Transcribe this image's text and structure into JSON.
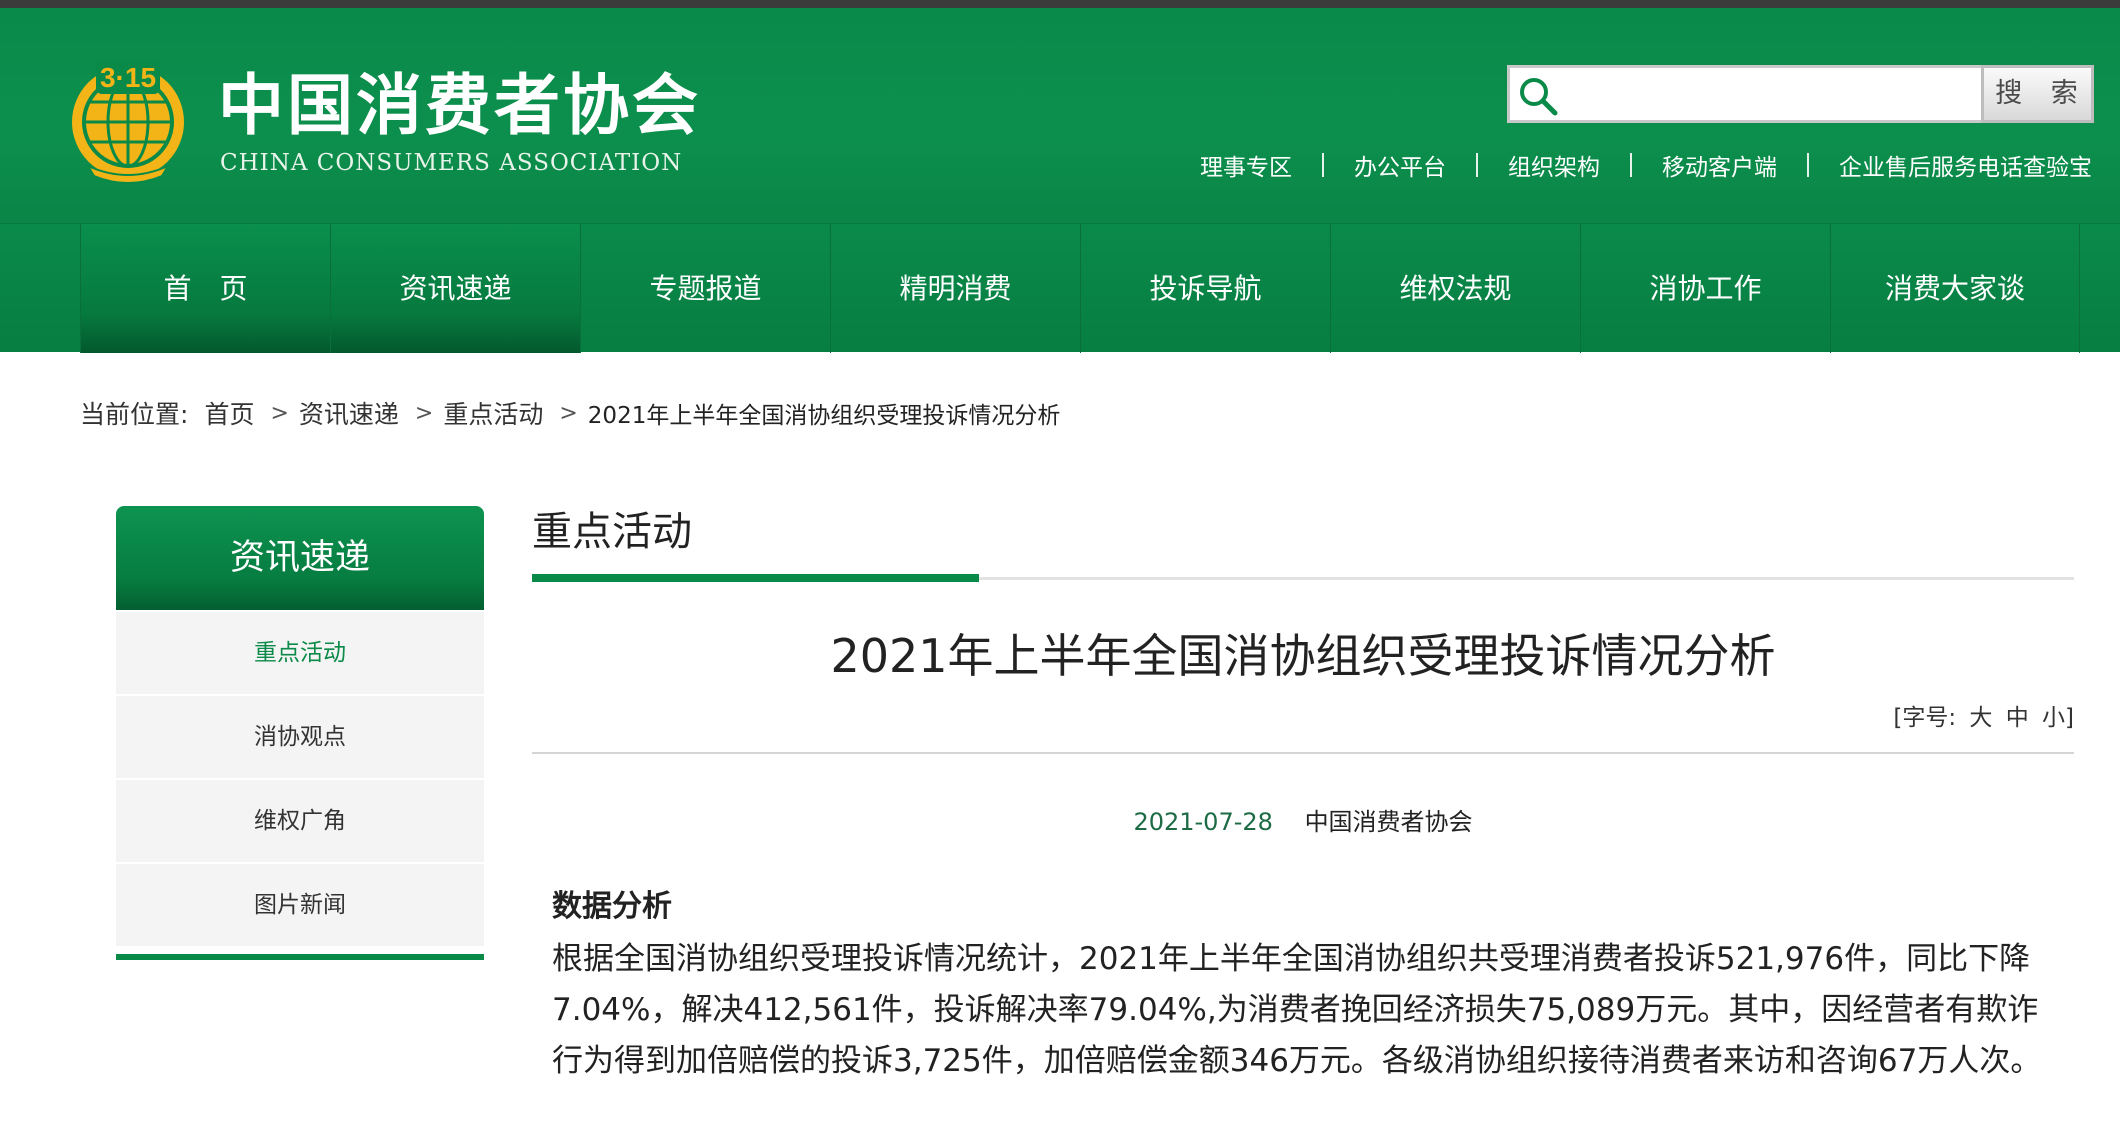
{
  "header": {
    "org_name_cn": "中国消费者协会",
    "org_name_en": "CHINA CONSUMERS ASSOCIATION",
    "logo_text": "3·15",
    "search": {
      "placeholder": "",
      "button_label": "搜 索"
    },
    "quick_links": [
      "理事专区",
      "办公平台",
      "组织架构",
      "移动客户端",
      "企业售后服务电话查验宝"
    ]
  },
  "nav": {
    "items": [
      "首　页",
      "资讯速递",
      "专题报道",
      "精明消费",
      "投诉导航",
      "维权法规",
      "消协工作",
      "消费大家谈"
    ],
    "active_index": 1
  },
  "breadcrumb": {
    "label": "当前位置:",
    "items": [
      "首页",
      "资讯速递",
      "重点活动"
    ],
    "current": "2021年上半年全国消协组织受理投诉情况分析",
    "separator": ">"
  },
  "sidebar": {
    "title": "资讯速递",
    "items": [
      "重点活动",
      "消协观点",
      "维权广角",
      "图片新闻"
    ],
    "active_index": 0
  },
  "main": {
    "section_title": "重点活动",
    "article_title": "2021年上半年全国消协组织受理投诉情况分析",
    "font_size_label": "[字号:",
    "font_size_options": [
      "大",
      "中",
      "小]"
    ],
    "date": "2021-07-28",
    "source": "中国消费者协会",
    "subheading": "数据分析",
    "paragraph": "根据全国消协组织受理投诉情况统计，2021年上半年全国消协组织共受理消费者投诉521,976件，同比下降7.04%，解决412,561件，投诉解决率79.04%,为消费者挽回经济损失75,089万元。其中，因经营者有欺诈行为得到加倍赔偿的投诉3,725件，加倍赔偿金额346万元。各级消协组织接待消费者来访和咨询67万人次。"
  },
  "colors": {
    "brand_green": "#0a8a49",
    "logo_gold": "#f2b417",
    "date_green": "#1c6b45"
  },
  "icons": {
    "search": "magnifier-icon",
    "logo": "globe-emblem-icon"
  }
}
